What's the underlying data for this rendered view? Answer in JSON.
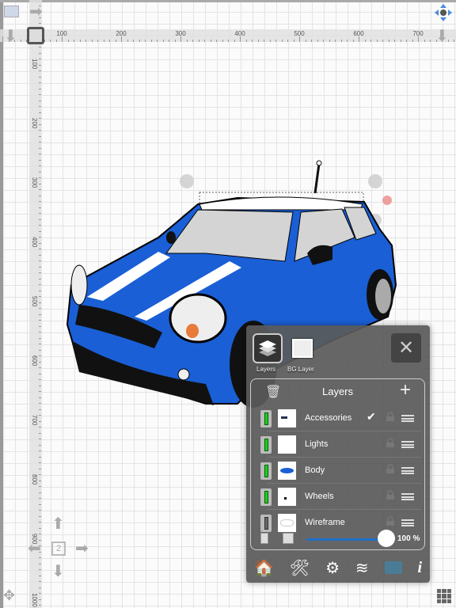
{
  "rulers": {
    "horizontal": [
      "100",
      "200",
      "300",
      "400",
      "500",
      "600",
      "700"
    ],
    "vertical": [
      "100",
      "200",
      "300",
      "400",
      "500",
      "600",
      "700",
      "800",
      "900",
      "1000"
    ]
  },
  "page_indicator": "2",
  "panel": {
    "tabs": [
      {
        "label": "Layers",
        "icon": "layers-icon",
        "selected": true
      },
      {
        "label": "BG Layer",
        "icon": "image-icon",
        "selected": false
      }
    ],
    "title": "Layers",
    "layers": [
      {
        "name": "Accessories",
        "visible": true,
        "active": true,
        "locked": false
      },
      {
        "name": "Lights",
        "visible": true,
        "active": false,
        "locked": false
      },
      {
        "name": "Body",
        "visible": true,
        "active": false,
        "locked": false
      },
      {
        "name": "Wheels",
        "visible": true,
        "active": false,
        "locked": false
      },
      {
        "name": "Wireframe",
        "visible": false,
        "active": false,
        "locked": false
      }
    ],
    "opacity_percent": 100,
    "opacity_label": "100 %",
    "toolbar": [
      "home-icon",
      "tools-icon",
      "gear-icon",
      "layers-icon",
      "folder-icon",
      "info-icon"
    ]
  },
  "colors": {
    "car_body": "#1a5fd6",
    "slider": "#1e6fc9"
  }
}
